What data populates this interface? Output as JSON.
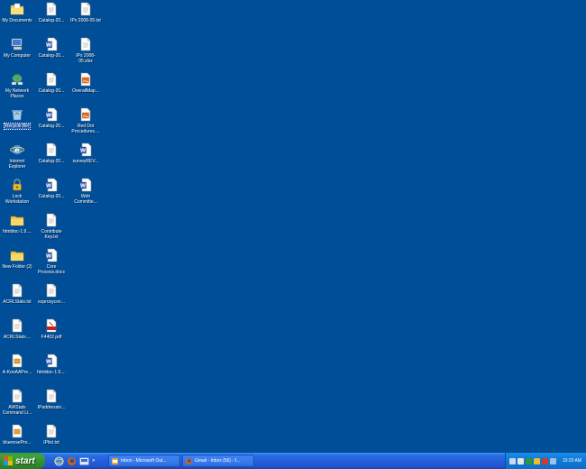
{
  "desktop": {
    "background": "#004e98",
    "col1": [
      {
        "label": "My Documents",
        "icon": "my-documents-icon"
      },
      {
        "label": "My Computer",
        "icon": "my-computer-icon"
      },
      {
        "label": "My Network Places",
        "icon": "my-network-places-icon"
      },
      {
        "label": "Recycle Bin",
        "icon": "recycle-bin-icon",
        "selected": true
      },
      {
        "label": "Internet Explorer",
        "icon": "internet-explorer-icon"
      },
      {
        "label": "Lock Workstation",
        "icon": "lock-icon"
      },
      {
        "label": "htmldoc-1.9....",
        "icon": "folder-icon"
      },
      {
        "label": "New Folder (2)",
        "icon": "folder-icon"
      },
      {
        "label": "ACRLStats.txt",
        "icon": "text-file-icon"
      },
      {
        "label": "ACRLStats....",
        "icon": "text-file-icon"
      },
      {
        "label": "A-KonAAPre...",
        "icon": "document-icon"
      },
      {
        "label": "AWStats Command Li...",
        "icon": "text-file-icon"
      },
      {
        "label": "bluerosePro...",
        "icon": "document-icon"
      }
    ],
    "col2": [
      {
        "label": "Catalog-20...",
        "icon": "text-file-icon"
      },
      {
        "label": "Catalog-20...",
        "icon": "word-document-icon"
      },
      {
        "label": "Catalog-20...",
        "icon": "text-file-icon"
      },
      {
        "label": "Catalog-20...",
        "icon": "word-document-icon"
      },
      {
        "label": "Catalog-20...",
        "icon": "text-file-icon"
      },
      {
        "label": "Catalog-20...",
        "icon": "word-document-icon"
      },
      {
        "label": "Contribute Key.txt",
        "icon": "text-file-icon"
      },
      {
        "label": "Core Process.docx",
        "icon": "word-document-icon"
      },
      {
        "label": "ezproxycon...",
        "icon": "text-file-icon"
      },
      {
        "label": "F4402.pdf",
        "icon": "pdf-icon"
      },
      {
        "label": "htmldoc-1.9....",
        "icon": "word-document-icon"
      },
      {
        "label": "IPaddressin...",
        "icon": "text-file-icon"
      },
      {
        "label": "IPlist.txt",
        "icon": "text-file-icon"
      }
    ],
    "col3": [
      {
        "label": "IPs 2008-05.txt",
        "icon": "text-file-icon"
      },
      {
        "label": "IPs 2008-05.xlsx",
        "icon": "text-file-icon"
      },
      {
        "label": "OverallMap...",
        "icon": "image-file-icon"
      },
      {
        "label": "Red Dot Procedures....",
        "icon": "image-file-icon"
      },
      {
        "label": "surveyREV...",
        "icon": "word-document-icon"
      },
      {
        "label": "Web Committe...",
        "icon": "word-document-icon"
      }
    ]
  },
  "taskbar": {
    "start_label": "start",
    "tasks": [
      {
        "label": "Inbox - Microsoft Out...",
        "icon": "outlook-icon"
      },
      {
        "label": "Gmail - Inbox (56) - f...",
        "icon": "firefox-icon"
      }
    ],
    "quick_chevron": "»",
    "clock": "10:20 AM"
  }
}
